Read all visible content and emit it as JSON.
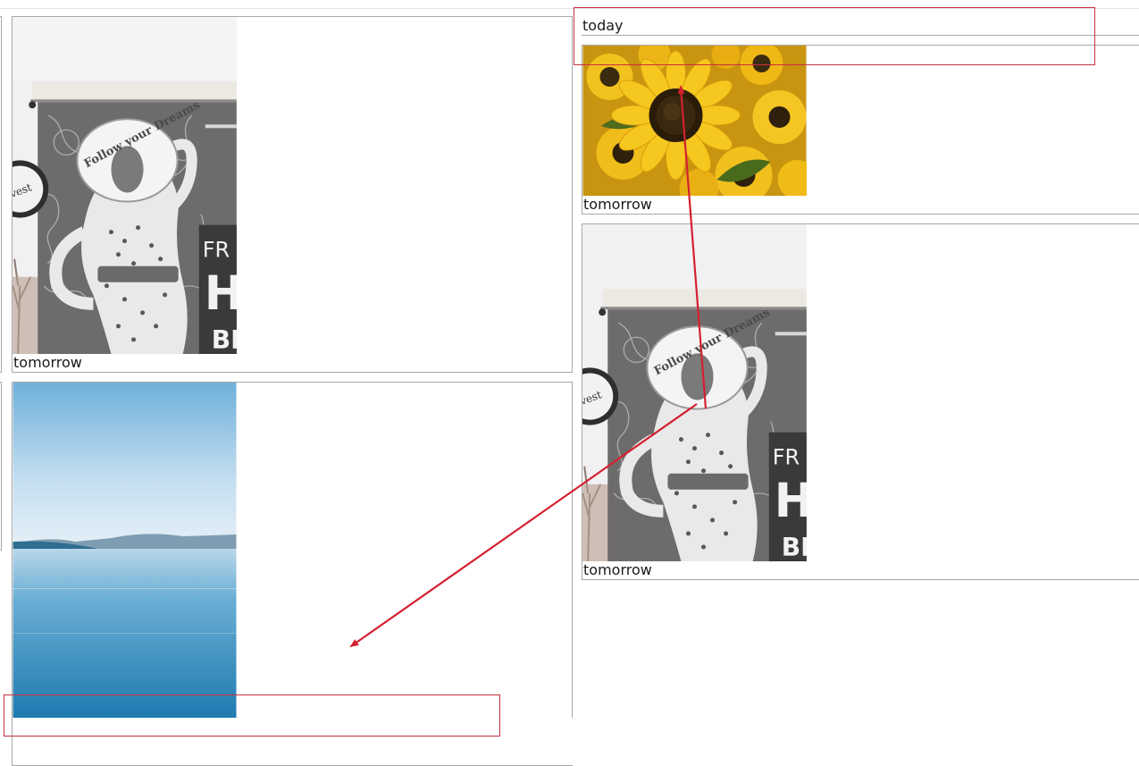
{
  "columns": {
    "left": {
      "cards": [
        {
          "image_name": "mural-image",
          "caption": "tomorrow"
        },
        {
          "image_name": "lake-image",
          "caption": ""
        }
      ]
    },
    "right": {
      "header_caption": "today",
      "cards": [
        {
          "image_name": "sunflower-image",
          "caption": "tomorrow"
        },
        {
          "image_name": "mural-image",
          "caption": "tomorrow"
        }
      ]
    }
  },
  "mural": {
    "wall_text": "Follow your Dreams",
    "sign_letters_1": "FR",
    "sign_letters_2": "H",
    "sign_letters_3": "BI",
    "round_sign": "vest"
  },
  "annotations": {
    "color": "#d42030",
    "box_color": "#c8303c"
  }
}
